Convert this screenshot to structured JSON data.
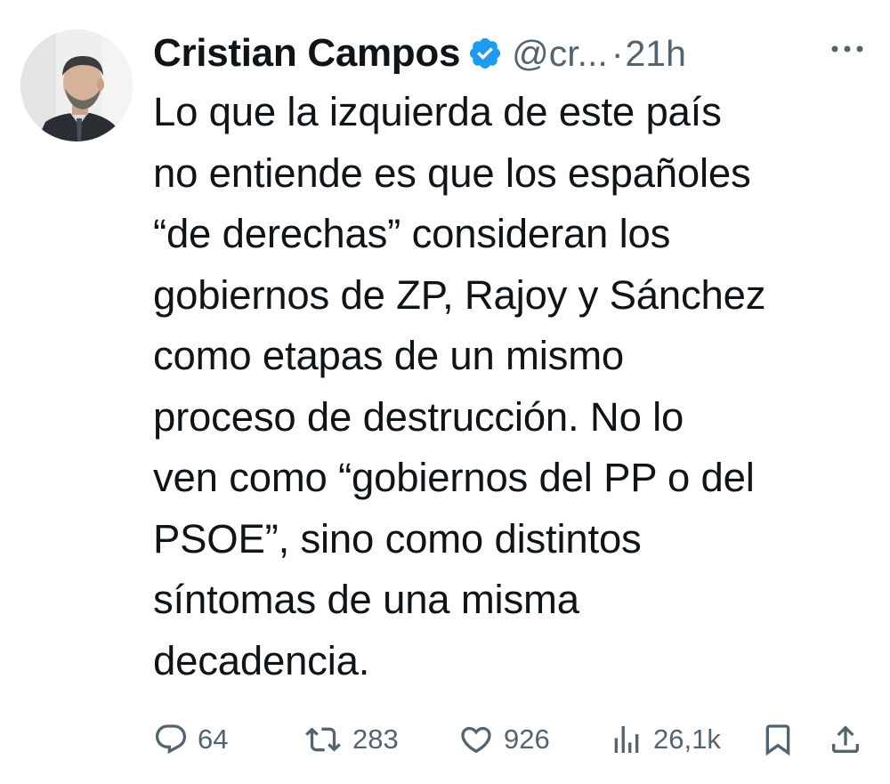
{
  "tweet": {
    "author": {
      "display_name": "Cristian Campos",
      "verified_badge_icon": "verified-badge-icon",
      "handle": "@cr...",
      "separator": "·",
      "time": "21h"
    },
    "more_icon": "more-horizontal-icon",
    "text_lines": [
      "Lo que la izquierda de este país",
      "no entiende es que los españoles",
      "“de derechas” consideran los",
      "gobiernos de ZP, Rajoy y Sánchez",
      "como etapas de un mismo",
      "proceso de destrucción. No lo",
      "ven como “gobiernos del PP o del",
      "PSOE”, sino como distintos",
      "síntomas de una misma",
      "decadencia."
    ],
    "actions": {
      "reply": {
        "icon": "reply-icon",
        "count": "64"
      },
      "retweet": {
        "icon": "retweet-icon",
        "count": "283"
      },
      "like": {
        "icon": "like-icon",
        "count": "926"
      },
      "views": {
        "icon": "views-icon",
        "count": "26,1k"
      },
      "bookmark": {
        "icon": "bookmark-icon"
      },
      "share": {
        "icon": "share-icon"
      }
    },
    "colors": {
      "text": "#0f1419",
      "secondary": "#536471",
      "verified": "#1d9bf0"
    }
  }
}
